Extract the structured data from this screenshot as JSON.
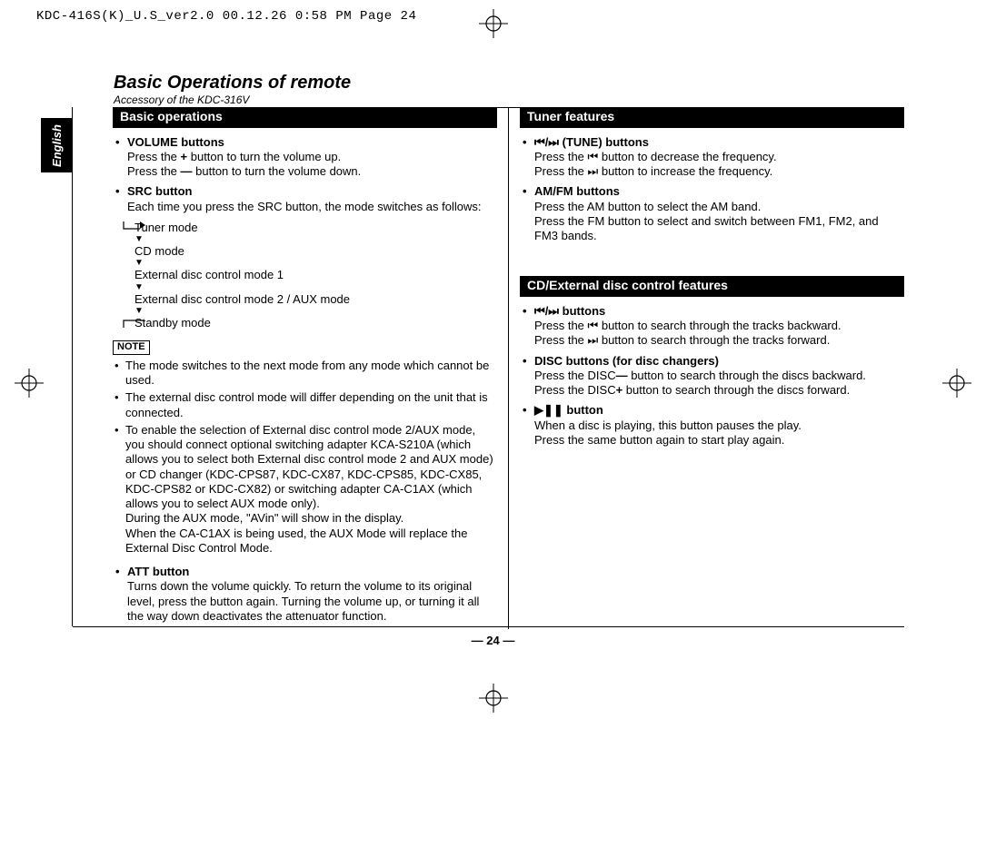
{
  "header": {
    "meta": "KDC-416S(K)_U.S_ver2.0  00.12.26 0:58 PM  Page 24"
  },
  "title": {
    "main": "Basic Operations of remote",
    "sub": "Accessory of the KDC-316V"
  },
  "lang": {
    "label": "English"
  },
  "footer": {
    "page": "— 24 —"
  },
  "left": {
    "bar": "Basic operations",
    "items": [
      {
        "title": "VOLUME buttons",
        "body": [
          "Press the ",
          "+",
          " button to turn the volume up.",
          "\n",
          "Press the ",
          "—",
          " button to turn the volume down."
        ]
      },
      {
        "title": "SRC button",
        "body": [
          "Each time you press the SRC button, the mode switches as follows:"
        ]
      }
    ],
    "modes": [
      "Tuner mode",
      "CD mode",
      "External disc control mode 1",
      "External disc control mode 2 / AUX mode",
      "Standby mode"
    ],
    "noteLabel": "NOTE",
    "notes": [
      "The mode switches to the next mode from any mode which cannot be used.",
      "The external disc control mode will differ depending on the unit that is connected.",
      "To enable the selection of External disc control mode 2/AUX mode, you should connect optional switching adapter KCA-S210A (which allows you to select both External disc control mode 2 and AUX mode) or CD changer (KDC-CPS87, KDC-CX87, KDC-CPS85, KDC-CX85, KDC-CPS82 or KDC-CX82) or switching adapter CA-C1AX (which allows you to select AUX mode only).\nDuring the AUX mode, \"AVin\" will show in the display.\nWhen the CA-C1AX is being used, the AUX Mode will replace the External Disc Control Mode."
    ],
    "att": {
      "title": "ATT button",
      "body": "Turns down the volume quickly. To return the volume to its original level, press the button again. Turning the volume up, or turning it all the way down deactivates the attenuator function."
    }
  },
  "right": {
    "tuner": {
      "bar": "Tuner features",
      "items": [
        {
          "title": [
            "⏮/⏭ (TUNE) buttons"
          ],
          "body": [
            "Press the ",
            "⏮",
            " button to decrease the frequency.",
            "\n",
            "Press the ",
            "⏭",
            " button to increase the frequency."
          ]
        },
        {
          "title": "AM/FM buttons",
          "body": [
            "Press the AM button to select the AM band.",
            "\n",
            "Press the FM button to select and switch between FM1, FM2, and FM3 bands."
          ]
        }
      ]
    },
    "cd": {
      "bar": "CD/External disc control features",
      "items": [
        {
          "title": [
            "⏮/⏭ buttons"
          ],
          "body": [
            "Press the ",
            "⏮",
            " button to search through the tracks backward.",
            "\n",
            "Press the ",
            "⏭",
            " button to search through the tracks forward."
          ]
        },
        {
          "title": "DISC buttons (for disc changers)",
          "body": [
            "Press the DISC",
            "—",
            " button to search through the discs backward.",
            "\n",
            "Press the DISC",
            "+",
            " button to search through the discs forward."
          ]
        },
        {
          "title": [
            "▶❚❚ button"
          ],
          "body": [
            "When a disc is playing, this button pauses the play.",
            "\n",
            "Press the same button again to start play again."
          ]
        }
      ]
    }
  }
}
